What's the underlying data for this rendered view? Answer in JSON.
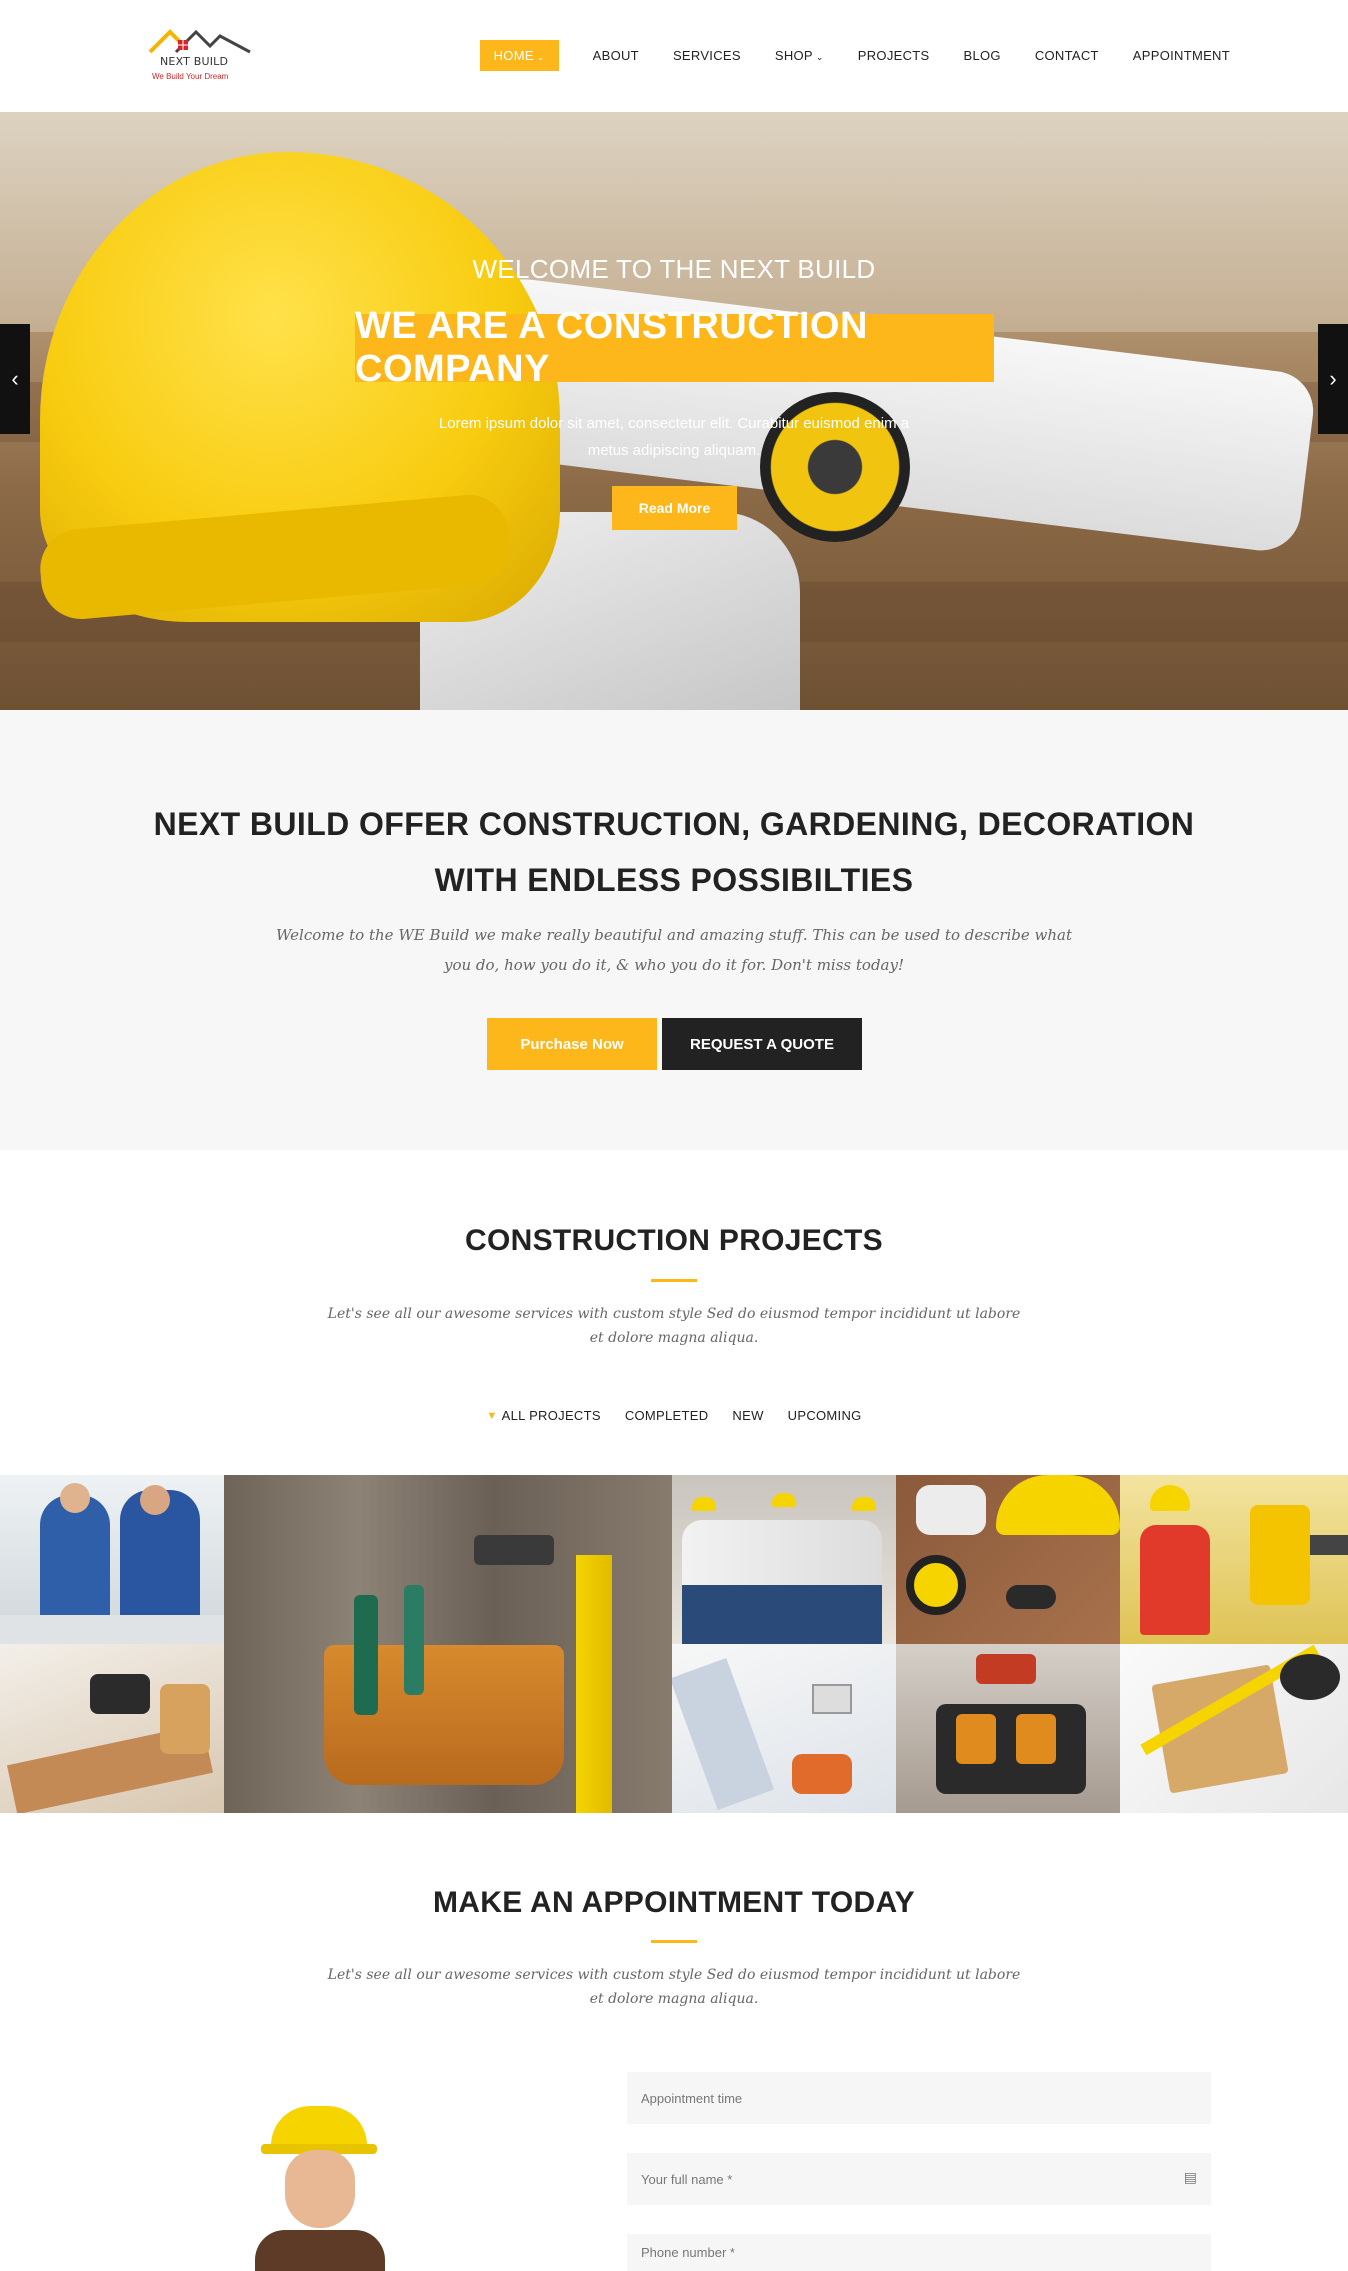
{
  "brand": {
    "name": "NEXT BUILD",
    "tagline": "We Build Your Dream",
    "accent": "#fdb71b"
  },
  "nav": {
    "items": [
      {
        "label": "HOME",
        "caret": "⌄"
      },
      {
        "label": "ABOUT"
      },
      {
        "label": "SERVICES"
      },
      {
        "label": "SHOP",
        "caret": "⌄"
      },
      {
        "label": "PROJECTS"
      },
      {
        "label": "BLOG"
      },
      {
        "label": "CONTACT"
      },
      {
        "label": "APPOINTMENT"
      }
    ]
  },
  "hero": {
    "kicker": "WELCOME TO THE NEXT BUILD",
    "headline": "WE ARE A CONSTRUCTION COMPANY",
    "subtext": "Lorem ipsum dolor sit amet, consectetur elit. Curabitur euismod enim a metus adipiscing aliquam.",
    "button": "Read More",
    "prev_icon": "‹",
    "next_icon": "›"
  },
  "offer": {
    "title": "NEXT BUILD OFFER CONSTRUCTION, GARDENING, DECORATION WITH ENDLESS POSSIBILTIES",
    "description": "Welcome to the WE Build we make really beautiful and amazing stuff. This can be used to describe what you do, how you do it, & who you do it for. Don't miss today!",
    "primary_button": "Purchase Now",
    "secondary_button": "REQUEST A QUOTE"
  },
  "projects": {
    "title": "CONSTRUCTION PROJECTS",
    "description": "Let's see all our awesome services with custom style Sed do eiusmod tempor incididunt ut labore et dolore magna aliqua.",
    "filters": [
      "ALL PROJECTS",
      "COMPLETED",
      "NEW",
      "UPCOMING"
    ],
    "filter_icon": "▼"
  },
  "appointment": {
    "title": "MAKE AN APPOINTMENT TODAY",
    "description": "Let's see all our awesome services with custom style Sed do eiusmod tempor incididunt ut labore et dolore magna aliqua.",
    "fields": [
      {
        "placeholder": "Appointment time"
      },
      {
        "placeholder": "Your full name *",
        "icon": "▤"
      },
      {
        "placeholder": "Phone number *"
      }
    ]
  }
}
